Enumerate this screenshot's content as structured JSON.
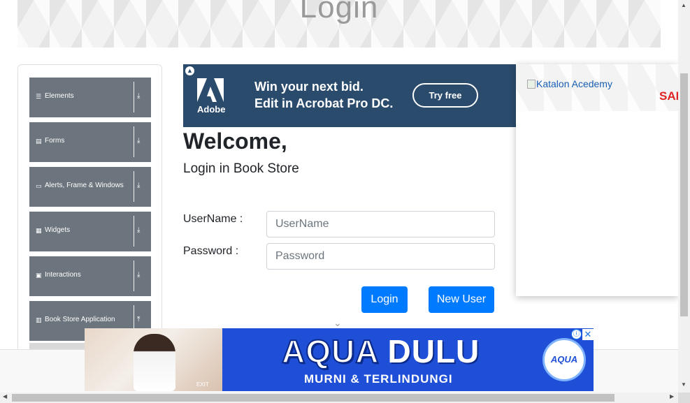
{
  "header": {
    "title": "Login"
  },
  "sidebar": {
    "groups": [
      {
        "label": "Elements",
        "icon": "list-icon",
        "chevron": "⤓"
      },
      {
        "label": "Forms",
        "icon": "form-icon",
        "chevron": "⤓"
      },
      {
        "label": "Alerts, Frame & Windows",
        "icon": "window-icon",
        "chevron": "⤓"
      },
      {
        "label": "Widgets",
        "icon": "grid-icon",
        "chevron": "⤓"
      },
      {
        "label": "Interactions",
        "icon": "square-icon",
        "chevron": "⤓"
      },
      {
        "label": "Book Store Application",
        "icon": "books-icon",
        "chevron": "⤒"
      }
    ]
  },
  "adobe_ad": {
    "brand": "Adobe",
    "headline_1": "Win your next bid.",
    "headline_2": "Edit in Acrobat Pro DC.",
    "cta": "Try free",
    "bg_color": "#2b4b6c"
  },
  "right_ad": {
    "image_alt": "Katalon Acedemy",
    "sale_fragment": "SAL"
  },
  "form": {
    "welcome": "Welcome,",
    "subtitle": "Login in Book Store",
    "username_label": "UserName :",
    "username_placeholder": "UserName",
    "password_label": "Password :",
    "password_placeholder": "Password",
    "login_button": "Login",
    "new_user_button": "New User",
    "accent_color": "#007bff"
  },
  "bottom_ad": {
    "title_brand": "AQUA",
    "title_rest": "DULU",
    "subtitle": "MURNI & TERLINDUNGI",
    "logo_text": "AQUA",
    "photo_caption": "EXIT",
    "info_icon": "ⓘ",
    "close_icon": "✕",
    "bg_color": "#1f4fd6"
  }
}
